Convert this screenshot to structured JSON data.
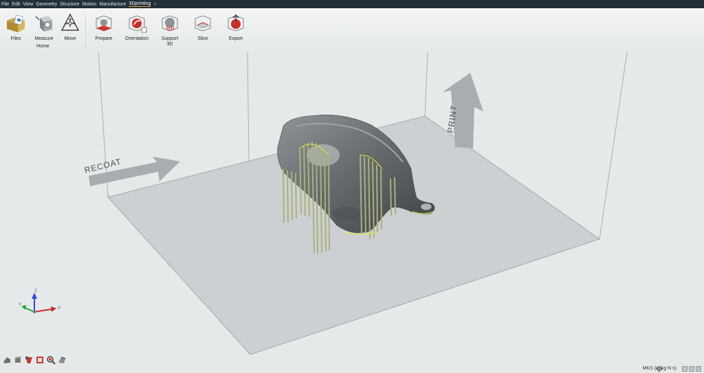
{
  "menu": {
    "items": [
      "File",
      "Edit",
      "View",
      "Geometry",
      "Structure",
      "Motion",
      "Manufacture",
      "3Dprinting"
    ],
    "add": "+"
  },
  "ribbon": {
    "files": "Files",
    "measure": "Measure",
    "home": "Home",
    "move": "Move",
    "prepare": "Prepare",
    "orientation": "Orientation",
    "support": "Support",
    "support_sub": "3D",
    "slice": "Slice",
    "export": "Export"
  },
  "viewport": {
    "recoat_label": "RECOAT",
    "print_label": "PRINT",
    "triad": {
      "z": "Z",
      "y": "Y",
      "x": "X"
    }
  },
  "status": {
    "units": "MKS (m kg N s)"
  },
  "colors": {
    "menubar": "#23303a",
    "support": "#b7c08a",
    "accent": "#e0a030",
    "model": "#6f7375"
  },
  "icons": {
    "files": "folder-files-icon",
    "measure": "measure-icon",
    "move": "move-icon",
    "prepare": "prepare-icon",
    "orientation": "orientation-icon",
    "support": "support-icon",
    "slice": "slice-icon",
    "export": "export-icon"
  }
}
